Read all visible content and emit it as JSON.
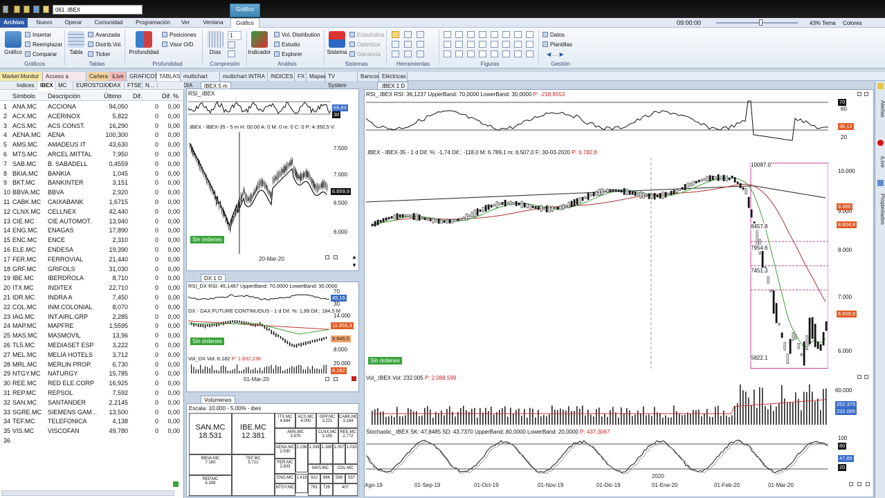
{
  "titlebar": {
    "document_name": "061 .IBEX",
    "context_tab": "Gráfico"
  },
  "menu": {
    "tabs": [
      "Archivo",
      "Nuevo",
      "Operar",
      "Comunidad",
      "Programación",
      "Ver",
      "Ventana",
      "Gráfico"
    ],
    "active": "Archivo",
    "selected": "Gráfico"
  },
  "status": {
    "clock": "09:00:00",
    "zoom": "43%",
    "tema": "Tema",
    "colores": "Colores"
  },
  "ribbon": {
    "grafico": {
      "label": "Gráfico",
      "insertar": "Insertar",
      "reemplazar": "Reemplazar",
      "comparar": "Comparar",
      "group": "Gráficos"
    },
    "tablas": {
      "tabla": "Tabla",
      "avanzada": "Avanzada",
      "distrib": "Distrib.Vol.",
      "ticker": "Ticker",
      "group": "Tablas"
    },
    "profundidad": {
      "label": "Profundidad",
      "posiciones": "Posiciones",
      "visor": "Visor O/D",
      "group": "Profundidad"
    },
    "compresion": {
      "dias": "Días",
      "value": "1",
      "group": "Compresión"
    },
    "analisis": {
      "indicador": "Indicador",
      "vol_dist": "Vol. Distribution",
      "estudio": "Estudio",
      "explorer": "Explorer",
      "group": "Análisis"
    },
    "sistemas": {
      "sistema": "Sistema",
      "estadistica": "Estadística",
      "optimizar": "Optimizar",
      "ganancia": "Ganancia",
      "group": "Sistemas"
    },
    "herramientas": {
      "group": "Herramientas"
    },
    "figuras": {
      "group": "Figuras"
    },
    "gestion": {
      "datos": "Datos",
      "plantillas": "Plantillas",
      "group": "Gestión"
    }
  },
  "workspace_tabs": [
    "Market Monitor",
    "Acceso a Broker",
    "Cartera",
    "iLive",
    "GRAFICOS",
    "TABLAS",
    "multichart DIA",
    "multichart INTRA",
    "INDICES",
    "FX",
    "Mapas",
    "TV System",
    "Bancos",
    "Eléctricas"
  ],
  "left_tabs": [
    "Indices",
    "IBEX",
    "MC",
    "EUROSTOXX",
    "DAX",
    "FTSE",
    "N..."
  ],
  "table": {
    "headers": {
      "symbol": "Símbolo",
      "desc": "Descripción",
      "last": "Último",
      "dif": "Dif.",
      "difpct": "Dif. %"
    },
    "rows": [
      {
        "n": "1",
        "s": "ANA.MC",
        "d": "ACCIONA",
        "u": "94,050",
        "f": "0",
        "p": "0,00"
      },
      {
        "n": "2",
        "s": "ACX.MC",
        "d": "ACERINOX",
        "u": "5,822",
        "f": "0",
        "p": "0,00"
      },
      {
        "n": "3",
        "s": "ACS.MC",
        "d": "ACS CONST.",
        "u": "16,290",
        "f": "0",
        "p": "0,00"
      },
      {
        "n": "4",
        "s": "AENA.MC",
        "d": "AENA",
        "u": "100,300",
        "f": "0",
        "p": "0,00"
      },
      {
        "n": "5",
        "s": "AMS.MC",
        "d": "AMADEUS IT",
        "u": "43,630",
        "f": "0",
        "p": "0,00"
      },
      {
        "n": "6",
        "s": "MTS.MC",
        "d": "ARCEL.MITTAL",
        "u": "7,950",
        "f": "0",
        "p": "0,00"
      },
      {
        "n": "7",
        "s": "SAB.MC",
        "d": "B. SABADELL",
        "u": "0,4559",
        "f": "0",
        "p": "0,00"
      },
      {
        "n": "8",
        "s": "BKIA.MC",
        "d": "BANKIA",
        "u": "1,045",
        "f": "0",
        "p": "0,00"
      },
      {
        "n": "9",
        "s": "BKT.MC",
        "d": "BANKINTER",
        "u": "3,151",
        "f": "0",
        "p": "0,00"
      },
      {
        "n": "10",
        "s": "BBVA.MC",
        "d": "BBVA",
        "u": "2,920",
        "f": "0",
        "p": "0,00"
      },
      {
        "n": "11",
        "s": "CABK.MC",
        "d": "CAIXABANK",
        "u": "1,6715",
        "f": "0",
        "p": "0,00"
      },
      {
        "n": "12",
        "s": "CLNX.MC",
        "d": "CELLNEX",
        "u": "42,440",
        "f": "0",
        "p": "0,00"
      },
      {
        "n": "13",
        "s": "CIE.MC",
        "d": "CIE AUTOMOT.",
        "u": "13,940",
        "f": "0",
        "p": "0,00"
      },
      {
        "n": "14",
        "s": "ENG.MC",
        "d": "ENAGAS",
        "u": "17,890",
        "f": "0",
        "p": "0,00"
      },
      {
        "n": "15",
        "s": "ENC.MC",
        "d": "ENCE",
        "u": "2,310",
        "f": "0",
        "p": "0,00"
      },
      {
        "n": "16",
        "s": "ELE.MC",
        "d": "ENDESA",
        "u": "19,390",
        "f": "0",
        "p": "0,00"
      },
      {
        "n": "17",
        "s": "FER.MC",
        "d": "FERROVIAL",
        "u": "21,440",
        "f": "0",
        "p": "0,00"
      },
      {
        "n": "18",
        "s": "GRF.MC",
        "d": "GRIFOLS",
        "u": "31,030",
        "f": "0",
        "p": "0,00"
      },
      {
        "n": "19",
        "s": "IBE.MC",
        "d": "IBERDROLA",
        "u": "8,710",
        "f": "0",
        "p": "0,00"
      },
      {
        "n": "20",
        "s": "ITX.MC",
        "d": "INDITEX",
        "u": "22,710",
        "f": "0",
        "p": "0,00"
      },
      {
        "n": "21",
        "s": "IDR.MC",
        "d": "INDRA A",
        "u": "7,450",
        "f": "0",
        "p": "0,00"
      },
      {
        "n": "22",
        "s": "COL.MC",
        "d": "INM.COLONIAL",
        "u": "8,070",
        "f": "0",
        "p": "0,00"
      },
      {
        "n": "23",
        "s": "IAG.MC",
        "d": "INT.AIRL.GRP",
        "u": "2,285",
        "f": "0",
        "p": "0,00"
      },
      {
        "n": "24",
        "s": "MAP.MC",
        "d": "MAPFRE",
        "u": "1,5595",
        "f": "0",
        "p": "0,00"
      },
      {
        "n": "25",
        "s": "MAS.MC",
        "d": "MASMOVIL",
        "u": "13,96",
        "f": "0",
        "p": "0,00"
      },
      {
        "n": "26",
        "s": "TL5.MC",
        "d": "MEDIASET ESP",
        "u": "3,222",
        "f": "0",
        "p": "0,00"
      },
      {
        "n": "27",
        "s": "MEL.MC",
        "d": "MELIA HOTELS",
        "u": "3,712",
        "f": "0",
        "p": "0,00"
      },
      {
        "n": "28",
        "s": "MRL.MC",
        "d": "MERLIN PROP.",
        "u": "6,730",
        "f": "0",
        "p": "0,00"
      },
      {
        "n": "29",
        "s": "NTGY.MC",
        "d": "NATURGY",
        "u": "15,785",
        "f": "0",
        "p": "0,00"
      },
      {
        "n": "30",
        "s": "REE.MC",
        "d": "RED ELE.CORP",
        "u": "16,925",
        "f": "0",
        "p": "0,00"
      },
      {
        "n": "31",
        "s": "REP.MC",
        "d": "REPSOL",
        "u": "7,592",
        "f": "0",
        "p": "0,00"
      },
      {
        "n": "32",
        "s": "SAN.MC",
        "d": "SANTANDER",
        "u": "2,2145",
        "f": "0",
        "p": "0,00"
      },
      {
        "n": "33",
        "s": "SGRE.MC",
        "d": "SIEMENS GAM...",
        "u": "13,500",
        "f": "0",
        "p": "0,00"
      },
      {
        "n": "34",
        "s": "TEF.MC",
        "d": "TELEFONICA",
        "u": "4,138",
        "f": "0",
        "p": "0,00"
      },
      {
        "n": "35",
        "s": "VIS.MC",
        "d": "VISCOFAN",
        "u": "49,780",
        "f": "0",
        "p": "0,00"
      },
      {
        "n": "36",
        "s": "",
        "d": "",
        "u": "",
        "f": "",
        "p": ""
      }
    ]
  },
  "chart_5m": {
    "tab": "IBEX 5 m",
    "rsi_title": "RSI_.IBEX",
    "rsi_badges": [
      "69,83",
      "30"
    ],
    "price_title": ".IBEX - IBEX-35 - 5 m  H: 00:00  A: 0  M: 0  m: 0  C: 0  P: 4.350,5  V:",
    "yticks": [
      "7.500",
      "7.000",
      "6.500",
      "6.000"
    ],
    "last": "6.659,9",
    "xlabel": "20-Mar-20",
    "orders": "Sin órdenes"
  },
  "chart_dax": {
    "tab": "DX 1 D",
    "rsi_title": "RSI_DX  RSI: 45,1487  UpperBand: 70,0000  LowerBand: 30,0000",
    "rsi_badge": "45,15",
    "rsi_yticks": [
      "70",
      "30"
    ],
    "price_title": "DX - DAX FUTURE CONTINUOUS - 1 d  Dif. %: 1,89  Dif.: 184,5  M",
    "yticks": [
      "14.000",
      "12.000",
      "10.000",
      "8.000"
    ],
    "badges": [
      "11.855,3",
      "9.945,5"
    ],
    "vol_title": "Vol_DX  Vol: 6.182",
    "vol_p": "P: 1.832,236",
    "vol_badges": [
      "20.000",
      "6.182"
    ],
    "xlabel": "01-Mar-20",
    "orders": "Sin órdenes"
  },
  "heatmap": {
    "tab": "Volúmenes",
    "scale": "Escala: 10.000 - 5,00% - ibex",
    "cells": [
      {
        "t": "SAN.MC",
        "v": "18.531",
        "big": true
      },
      {
        "t": "IBE.MC",
        "v": "12.381",
        "big": true
      },
      {
        "t": "ITX.MC",
        "v": "4.844"
      },
      {
        "t": "ACS.MC",
        "v": "4.000"
      },
      {
        "t": "GRF.MC",
        "v": "3.221"
      },
      {
        "t": "CABK.MC",
        "v": "3.184"
      },
      {
        "t": "AMS.MC",
        "v": "3.870"
      },
      {
        "t": "CLNX.MC",
        "v": "3.150"
      },
      {
        "t": "REE.MC",
        "v": "2.772"
      },
      {
        "t": "AENA.MC",
        "v": "2.530"
      },
      {
        "t": "FER.MC",
        "v": "2.603"
      },
      {
        "t": "",
        "v": "2.236"
      },
      {
        "t": "",
        "v": "1.339"
      },
      {
        "t": "",
        "v": "1.166"
      },
      {
        "t": "",
        "v": "1.057"
      },
      {
        "t": "",
        "v": "1.015"
      },
      {
        "t": "MAS.MC",
        "v": ""
      },
      {
        "t": "COL.MC",
        "v": ""
      },
      {
        "t": "BBVA.MC",
        "v": "7.160"
      },
      {
        "t": "TEF.MC",
        "v": "5.721"
      },
      {
        "t": "ENG.MC",
        "v": ""
      },
      {
        "t": "",
        "v": "1.418"
      },
      {
        "t": "",
        "v": "922"
      },
      {
        "t": "",
        "v": "866"
      },
      {
        "t": "",
        "v": "599"
      },
      {
        "t": "",
        "v": "537"
      },
      {
        "t": "REP.MC",
        "v": "6.308"
      },
      {
        "t": "NTGY.MC",
        "v": ""
      },
      {
        "t": "",
        "v": "781"
      },
      {
        "t": "",
        "v": "729"
      },
      {
        "t": "",
        "v": "407"
      }
    ]
  },
  "chart_daily": {
    "tab": ".IBEX 1 D",
    "rsi_title": "RSI_.IBEX  RSI: 36,1237  UpperBand: 70,0000  LowerBand: 30,0000",
    "rsi_p": "P: -218,8553",
    "rsi_yticks": [
      "70",
      "60",
      "40",
      "20"
    ],
    "rsi_badge": "36,12",
    "price_title": ".IBEX - IBEX-35 - 1 d  Dif. %: -1,74  Dif.: -118,0  M: 6.789,1  m: 6.507,0  F: 30-03-2020",
    "price_p": "P: 6.782,8",
    "yticks": [
      "10.000",
      "9.000",
      "8.000",
      "7.000",
      "6.000"
    ],
    "levels": [
      "10087.0",
      "8457.8",
      "7954.6",
      "7451.3",
      "5822.1"
    ],
    "badges": [
      "9.060",
      "8.604,8",
      "6.659,9"
    ],
    "orders": "Sin órdenes",
    "vol_title": "Vol_.IBEX  Vol: 232.005",
    "vol_p": "P: 2.088.599",
    "vol_yticks": [
      "60.000",
      "40.000",
      "20.000"
    ],
    "vol_badges": [
      "252.375",
      "232.005"
    ],
    "stoch_title": "Stochastic_.IBEX  SK: 47,8485  SD: 43,7370  UpperBand: 80,0000  LowerBand: 20,0000",
    "stoch_p": "P: 437,3067",
    "stoch_yticks": [
      "100",
      "80",
      "40",
      "20"
    ],
    "stoch_badge": "47,85",
    "year_label": "2020",
    "xlabels": [
      "Ago-19",
      "01-Sep-19",
      "01-Oct-19",
      "01-Nov-19",
      "01-Dic-19",
      "01-Ene-20",
      "01-Feb-20",
      "01-Mar-20"
    ]
  },
  "sidebar": {
    "alertas": "Alertas",
    "ilive": "iLive",
    "propiedades": "Propiedades"
  },
  "colors": {
    "accent": "#2b5aa8",
    "candle": "#111111",
    "ma_green": "#3aa33a",
    "ma_red": "#c03030",
    "fib": "#c040a0",
    "badge_blue": "#3a6cc8",
    "badge_red": "#e05a26"
  },
  "chart_data": [
    {
      "type": "line",
      "title": ".IBEX - IBEX-35 - 1 d",
      "x": [
        "Ago-19",
        "01-Sep-19",
        "01-Oct-19",
        "01-Nov-19",
        "01-Dic-19",
        "01-Ene-20",
        "01-Feb-20",
        "01-Mar-20"
      ],
      "series": [
        {
          "name": ".IBEX",
          "values": [
            8750,
            8950,
            9250,
            9200,
            9550,
            9650,
            9750,
            6660
          ]
        }
      ],
      "ylim": [
        5800,
        10200
      ]
    }
  ]
}
